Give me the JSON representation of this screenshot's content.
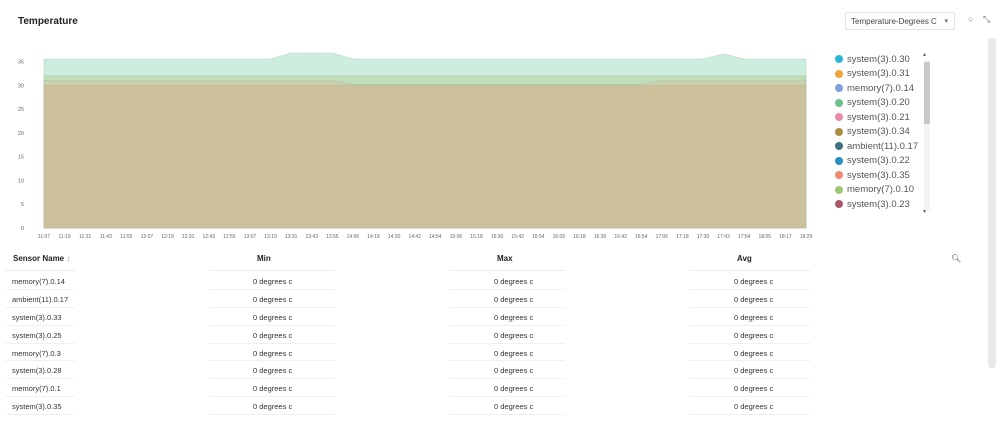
{
  "header": {
    "title": "Temperature",
    "metric_select": "Temperature-Degrees C",
    "refresh_icon": "circle-icon",
    "expand_icon": "expand-icon"
  },
  "chart_data": {
    "type": "area",
    "title": "",
    "y_ticks": [
      "35",
      "30",
      "25",
      "20",
      "15",
      "10",
      "5",
      "0"
    ],
    "ylim": [
      0,
      37
    ],
    "x_ticks": [
      "11:07",
      "11:19",
      "11:31",
      "11:43",
      "11:55",
      "12:07",
      "12:19",
      "12:31",
      "12:43",
      "12:55",
      "13:07",
      "13:19",
      "13:31",
      "13:43",
      "13:55",
      "14:06",
      "14:18",
      "14:30",
      "14:42",
      "14:54",
      "15:06",
      "15:18",
      "15:30",
      "15:42",
      "15:54",
      "16:06",
      "16:18",
      "16:30",
      "16:42",
      "16:54",
      "17:06",
      "17:18",
      "17:30",
      "17:42",
      "17:54",
      "18:05",
      "18:17",
      "18:29"
    ],
    "series": [
      {
        "name": "system(3).0.30",
        "color": "#2bb5d4",
        "upper": [
          35.5,
          35.5,
          35.5,
          35.5,
          35.5,
          35.5,
          35.5,
          35.5,
          35.5,
          35.5,
          35.5,
          35.5,
          36.8,
          36.8,
          36.8,
          35.5,
          35.5,
          35.5,
          35.5,
          35.5,
          35.5,
          35.5,
          35.5,
          35.5,
          35.5,
          35.5,
          35.5,
          35.5,
          35.5,
          35.5,
          35.5,
          35.5,
          35.5,
          36.6,
          35.5,
          35.5,
          35.5,
          35.5
        ]
      },
      {
        "name": "system(3).0.31",
        "color": "#f2a33a",
        "upper": [
          32,
          32,
          32,
          32,
          32,
          32,
          32,
          32,
          32,
          32,
          32,
          32,
          32,
          32,
          32,
          32,
          32,
          32,
          32,
          32,
          32,
          32,
          32,
          32,
          32,
          32,
          32,
          32,
          32,
          32,
          32,
          32,
          32,
          32,
          32,
          32,
          32,
          32
        ]
      },
      {
        "name": "memory(7).0.14",
        "color": "#7ba0de",
        "upper": [
          31,
          31,
          31,
          31,
          31,
          31,
          31,
          31,
          31,
          31,
          31,
          31,
          31,
          31,
          31,
          30.2,
          30.2,
          30.2,
          30.2,
          30.2,
          30.2,
          30.2,
          30.2,
          30.2,
          30.2,
          30.2,
          30.2,
          30.2,
          30.2,
          30.2,
          31,
          31,
          31,
          31,
          31,
          31,
          31,
          31
        ]
      },
      {
        "name": "system(3).0.20",
        "color": "#6cc08b",
        "upper": []
      },
      {
        "name": "system(3).0.21",
        "color": "#e98aa6",
        "upper": []
      },
      {
        "name": "system(3).0.34",
        "color": "#a99040",
        "upper": [
          30,
          30,
          30,
          30,
          30,
          30,
          30,
          30,
          30,
          30,
          30,
          30,
          30,
          30,
          30,
          30,
          30,
          30,
          30,
          30,
          30,
          30,
          30,
          30,
          30,
          30,
          30,
          30,
          30,
          30,
          30,
          30,
          30,
          30,
          30,
          30,
          30,
          30
        ]
      },
      {
        "name": "ambient(11).0.17",
        "color": "#3c7180",
        "upper": []
      },
      {
        "name": "system(3).0.22",
        "color": "#2a8fc0",
        "upper": []
      },
      {
        "name": "system(3).0.35",
        "color": "#ef8a72",
        "upper": []
      },
      {
        "name": "memory(7).0.10",
        "color": "#9cc873",
        "upper": []
      },
      {
        "name": "system(3).0.23",
        "color": "#a9586a",
        "upper": []
      }
    ]
  },
  "table": {
    "columns": [
      "Sensor Name",
      "Min",
      "Max",
      "Avg"
    ],
    "sort_icon": "sort-icon",
    "search_icon": "search-icon",
    "rows": [
      {
        "name": "memory(7).0.14",
        "min": "0 degrees c",
        "max": "0 degrees c",
        "avg": "0 degrees c"
      },
      {
        "name": "ambient(11).0.17",
        "min": "0 degrees c",
        "max": "0 degrees c",
        "avg": "0 degrees c"
      },
      {
        "name": "system(3).0.33",
        "min": "0 degrees c",
        "max": "0 degrees c",
        "avg": "0 degrees c"
      },
      {
        "name": "system(3).0.25",
        "min": "0 degrees c",
        "max": "0 degrees c",
        "avg": "0 degrees c"
      },
      {
        "name": "memory(7).0.3",
        "min": "0 degrees c",
        "max": "0 degrees c",
        "avg": "0 degrees c"
      },
      {
        "name": "system(3).0.28",
        "min": "0 degrees c",
        "max": "0 degrees c",
        "avg": "0 degrees c"
      },
      {
        "name": "memory(7).0.1",
        "min": "0 degrees c",
        "max": "0 degrees c",
        "avg": "0 degrees c"
      },
      {
        "name": "system(3).0.35",
        "min": "0 degrees c",
        "max": "0 degrees c",
        "avg": "0 degrees c"
      }
    ]
  }
}
